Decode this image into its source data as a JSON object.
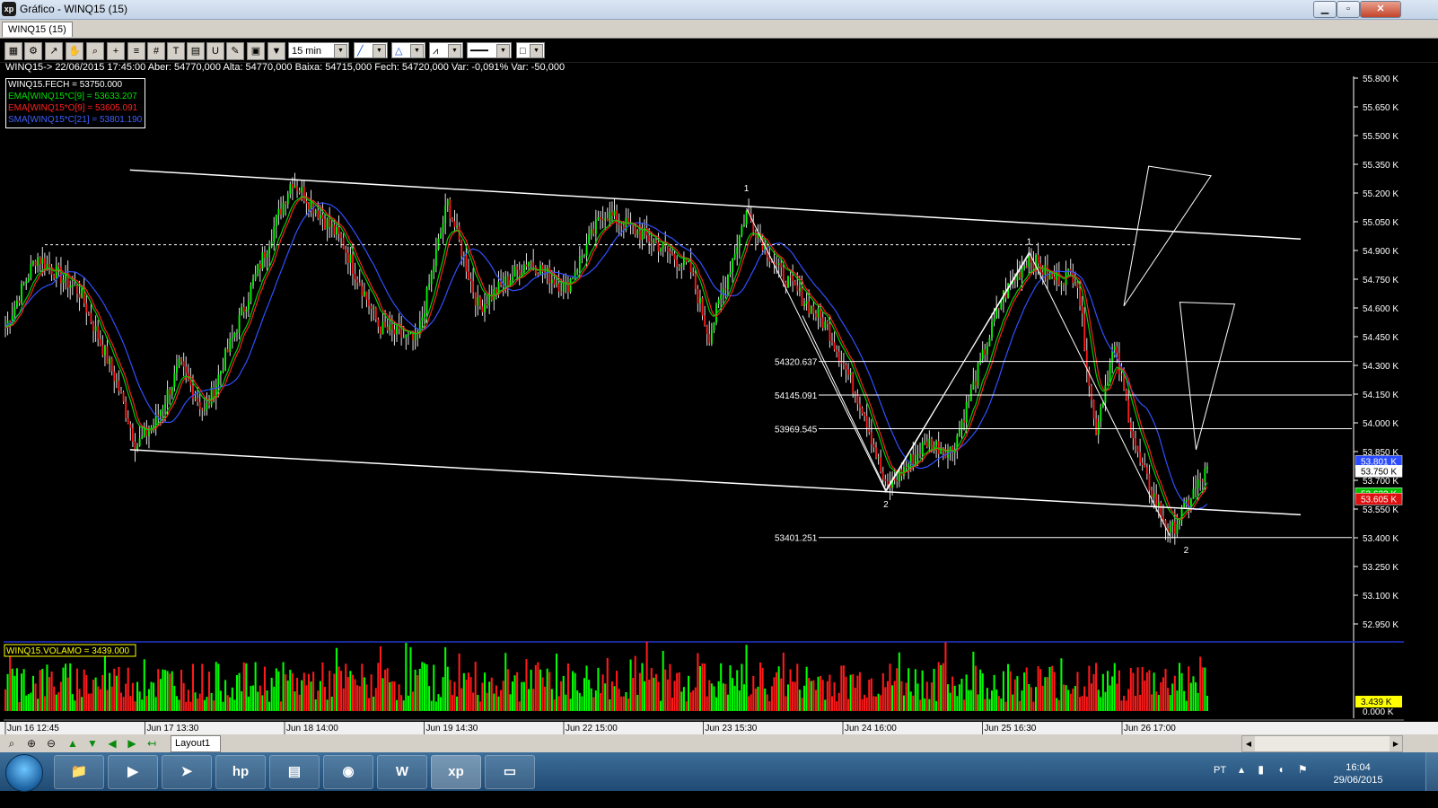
{
  "window": {
    "title": "Gráfico - WINQ15 (15)",
    "app_icon": "xp",
    "tab": "WINQ15 (15)"
  },
  "toolbar": {
    "timeframe": "15 min",
    "icons": [
      "chart-type-icon",
      "settings-icon",
      "draw-line-icon",
      "hand-icon",
      "zoom-icon",
      "crosshair-icon",
      "fibonacci-icon",
      "text-icon",
      "calculator-icon",
      "magnet-icon",
      "brush-icon",
      "clipboard-icon",
      "filter-icon"
    ]
  },
  "info_line": "WINQ15-> 22/06/2015 17:45:00 Aber: 54770,000 Alta: 54770,000 Baixa: 54715,000 Fech: 54720,000 Var: -0,091% Var: -50,000",
  "legend": [
    {
      "text": "WINQ15.FECH = 53750.000",
      "color": "#ffffff"
    },
    {
      "text": "EMA[WINQ15*C[9] = 53633.207",
      "color": "#00e000"
    },
    {
      "text": "EMA[WINQ15*O[9] = 53605.091",
      "color": "#ff2020"
    },
    {
      "text": "SMA[WINQ15*C[21] = 53801.190",
      "color": "#4060ff"
    }
  ],
  "chart_data": {
    "type": "candlestick",
    "price_axis": {
      "min": 52950,
      "max": 55800,
      "ticks": [
        "55.800 K",
        "55.650 K",
        "55.500 K",
        "55.350 K",
        "55.200 K",
        "55.050 K",
        "54.900 K",
        "54.750 K",
        "54.600 K",
        "54.450 K",
        "54.300 K",
        "54.150 K",
        "54.000 K",
        "53.850 K",
        "53.700 K",
        "53.550 K",
        "53.400 K",
        "53.250 K",
        "53.100 K",
        "52.950 K"
      ]
    },
    "x_ticks": [
      "Jun 16 12:45",
      "Jun 17 13:30",
      "Jun 18 14:00",
      "Jun 19 14:30",
      "Jun 22 15:00",
      "Jun 23 15:30",
      "Jun 24 16:00",
      "Jun 25 16:30",
      "Jun 26 17:00"
    ],
    "fib_levels": [
      {
        "label": "54320.637",
        "value": 54320.637
      },
      {
        "label": "54145.091",
        "value": 54145.091
      },
      {
        "label": "53969.545",
        "value": 53969.545
      },
      {
        "label": "53401.251",
        "value": 53401.251
      }
    ],
    "dashed_level": 54930,
    "price_badges": [
      {
        "label": "53.801 K",
        "value": 53801,
        "color": "#2a4bff"
      },
      {
        "label": "53.750 K",
        "value": 53750,
        "color": "#ffffff"
      },
      {
        "label": "53.633 K",
        "value": 53633,
        "color": "#00c000"
      },
      {
        "label": "53.605 K",
        "value": 53605,
        "color": "#e01010"
      }
    ],
    "wave_labels": [
      {
        "text": "1",
        "t": 0.595,
        "value": 55210
      },
      {
        "text": "1",
        "t": 0.822,
        "value": 54930
      },
      {
        "text": "2",
        "t": 0.707,
        "value": 53560
      },
      {
        "text": "2",
        "t": 0.948,
        "value": 53320
      }
    ],
    "channel": {
      "upper": {
        "t0": 0.1,
        "v0": 55320,
        "t1": 1.04,
        "v1": 54960
      },
      "lower": {
        "t0": 0.1,
        "v0": 53860,
        "t1": 1.04,
        "v1": 53520
      }
    },
    "zigzag_1": [
      [
        0.595,
        55120
      ],
      [
        0.707,
        53640
      ],
      [
        0.822,
        54890
      ],
      [
        0.935,
        53410
      ]
    ],
    "zigzag_2": [
      [
        0.64,
        54560
      ],
      [
        0.707,
        53650
      ],
      [
        0.822,
        54880
      ]
    ],
    "triangles": [
      [
        [
          0.918,
          55340
        ],
        [
          0.968,
          55290
        ],
        [
          0.898,
          54610
        ]
      ],
      [
        [
          0.943,
          54630
        ],
        [
          0.987,
          54620
        ],
        [
          0.956,
          53860
        ]
      ]
    ],
    "volume": {
      "label": "WINQ15.VOLAMO = 3439.000",
      "badge": "3.439 K",
      "axis_bottom": "0.000 K"
    }
  },
  "bottom_bar": {
    "layout_tab": "Layout1",
    "icons": [
      "zoom-fit-icon",
      "zoom-in-icon",
      "zoom-out-icon",
      "arrow-up-icon",
      "arrow-down-icon",
      "arrow-left-icon",
      "arrow-right-icon",
      "arrow-back-icon"
    ]
  },
  "taskbar": {
    "apps": [
      "file-explorer-icon",
      "media-player-icon",
      "network-icon",
      "hp-icon",
      "archive-icon",
      "chrome-icon",
      "word-icon",
      "xp-icon",
      "image-viewer-icon"
    ],
    "lang": "PT",
    "time": "16:04",
    "date": "29/06/2015"
  }
}
